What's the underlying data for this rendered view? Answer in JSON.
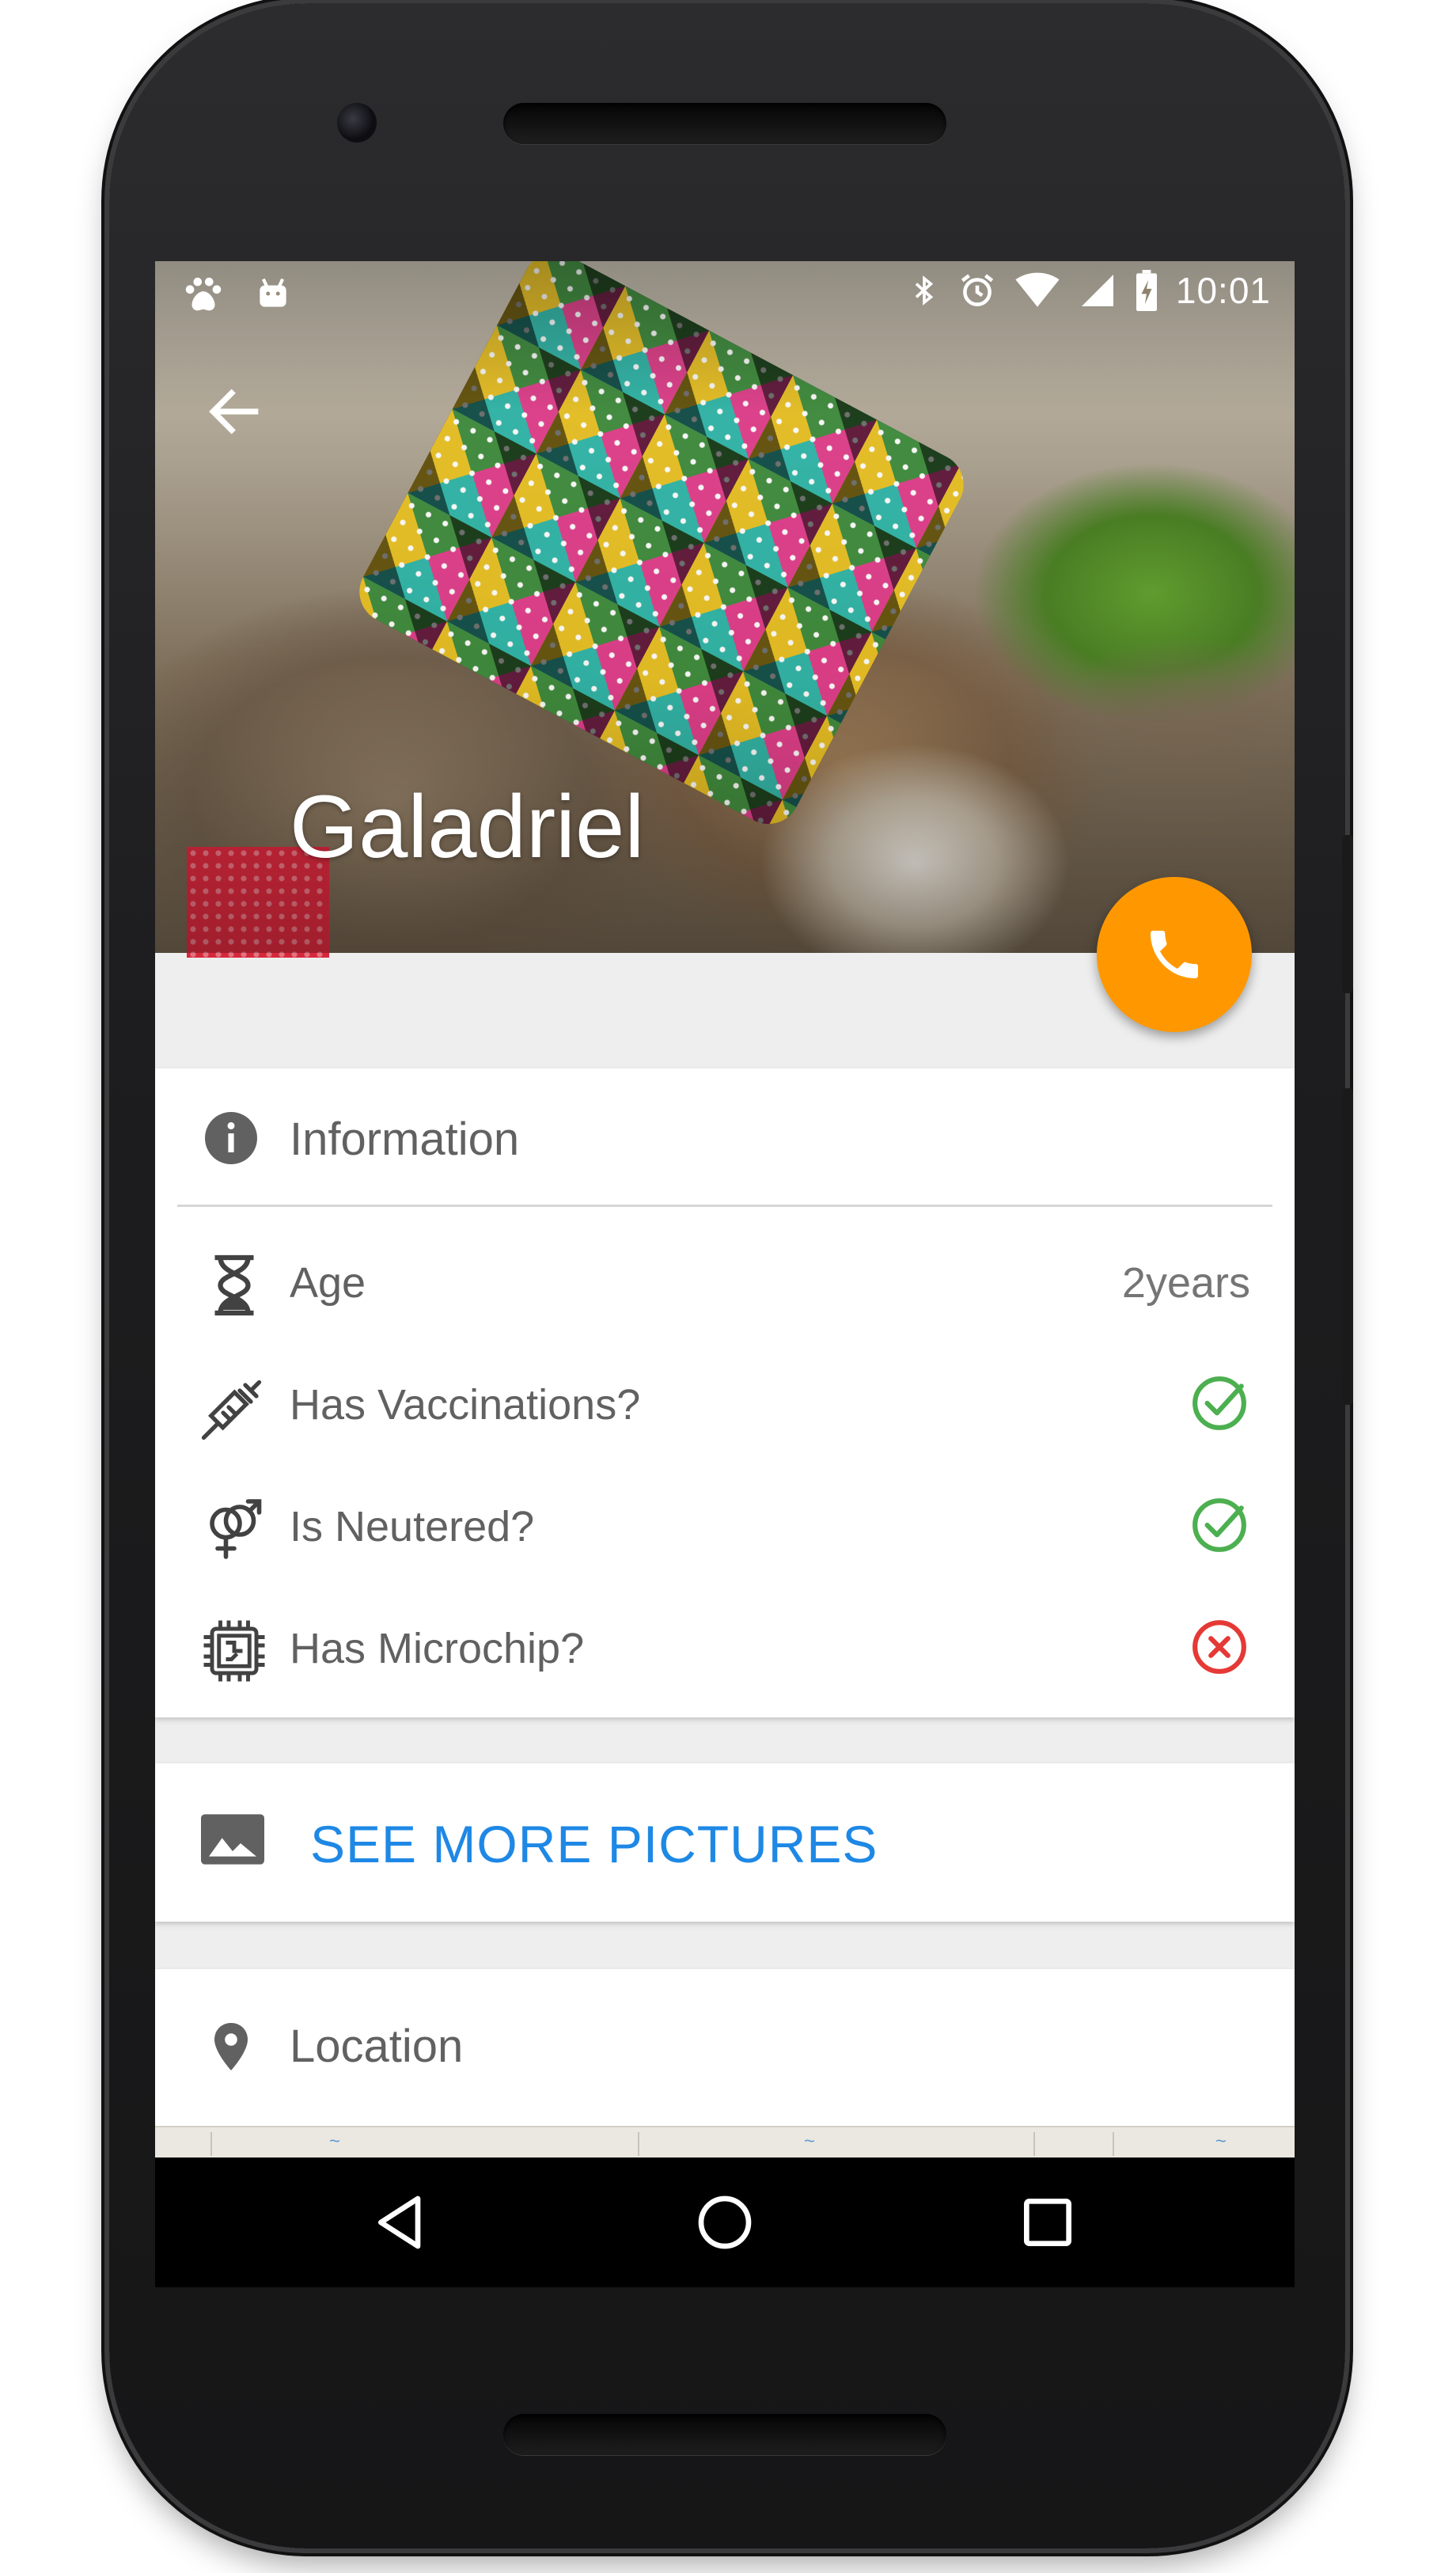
{
  "status_bar": {
    "time": "10:01",
    "left_icons": [
      "paw-icon",
      "android-icon"
    ],
    "right_icons": [
      "bluetooth-icon",
      "alarm-icon",
      "wifi-icon",
      "signal-icon",
      "battery-charging-icon"
    ]
  },
  "header": {
    "pet_name": "Galadriel",
    "back_icon": "arrow-back-icon",
    "fab_icon": "phone-icon",
    "fab_color": "#FF9800"
  },
  "information": {
    "title": "Information",
    "icon": "info-icon",
    "rows": [
      {
        "label": "Age",
        "icon": "hourglass-icon",
        "value": "2years"
      },
      {
        "label": "Has Vaccinations?",
        "icon": "syringe-icon",
        "status": "yes"
      },
      {
        "label": "Is Neutered?",
        "icon": "gender-icon",
        "status": "yes"
      },
      {
        "label": "Has Microchip?",
        "icon": "chip-icon",
        "status": "no"
      }
    ]
  },
  "pictures": {
    "label": "SEE MORE PICTURES",
    "icon": "image-icon",
    "color": "#1E88E5"
  },
  "location": {
    "title": "Location",
    "icon": "place-icon"
  },
  "colors": {
    "yes": "#4CAF50",
    "no": "#E53935",
    "text": "#616161"
  },
  "nav": {
    "icons": [
      "back-triangle-icon",
      "home-circle-icon",
      "recents-square-icon"
    ]
  }
}
